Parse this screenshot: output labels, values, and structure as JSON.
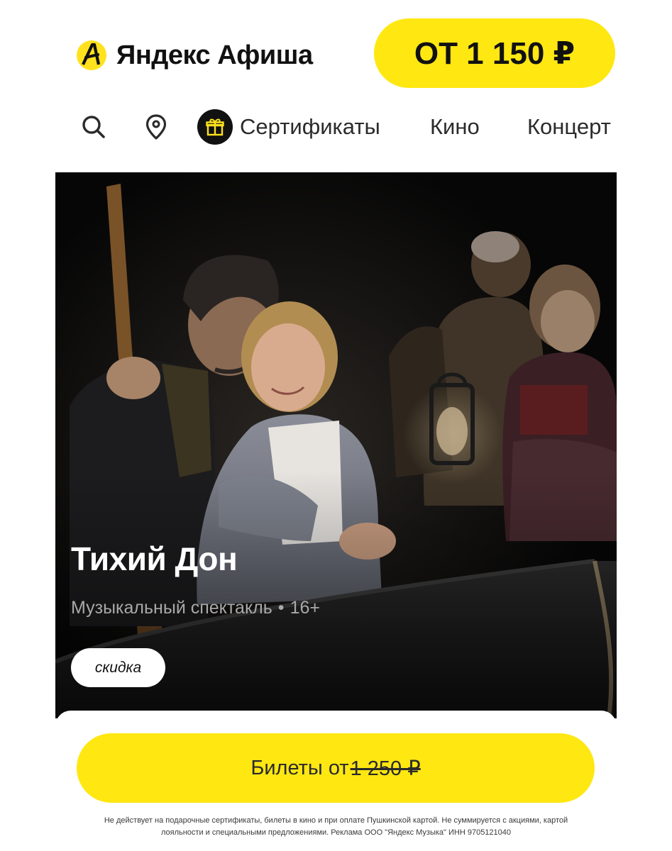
{
  "header": {
    "logo_text": "Яндекс Афиша",
    "price_pill": "ОТ 1 150 ₽"
  },
  "nav": {
    "certificates": "Сертификаты",
    "cinema": "Кино",
    "concerts": "Концерт"
  },
  "event": {
    "title": "Тихий Дон",
    "genre": "Музыкальный спектакль",
    "separator": "•",
    "age_rating": "16+",
    "badge": "скидка"
  },
  "tickets": {
    "label": "Билеты от",
    "old_price": "1 250 ₽"
  },
  "disclaimer": {
    "line1": "Не действует на подарочные сертификаты, билеты в кино и при оплате Пушкинской картой. Не суммируется с акциями, картой",
    "line2": "лояльности и специальными предложениями. Реклама ООО \"Яндекс Музыка\" ИНН 9705121040"
  },
  "colors": {
    "brand_yellow": "#ffe712",
    "text_dark": "#111111",
    "hero_background": "#060606",
    "meta_gray": "#a9a9a9"
  },
  "icons": {
    "logo": "afisha-logo-icon",
    "search": "search-icon",
    "location": "location-pin-icon",
    "gift": "gift-icon"
  }
}
